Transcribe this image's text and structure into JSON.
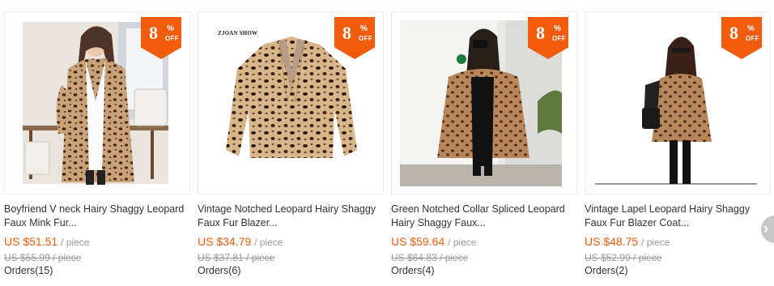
{
  "products": [
    {
      "title": "Boyfriend V neck Hairy Shaggy Leopard Faux Mink Fur...",
      "price": "US $51.51",
      "unit": "/ piece",
      "original_price": "US $55.99 / piece",
      "orders": "Orders(15)",
      "discount": "8",
      "pct": "%",
      "off": "OFF"
    },
    {
      "title": "Vintage Notched Leopard Hairy Shaggy Faux Fur Blazer...",
      "price": "US $34.79",
      "unit": "/ piece",
      "original_price": "US $37.81 / piece",
      "orders": "Orders(6)",
      "discount": "8",
      "pct": "%",
      "off": "OFF",
      "brand": "ZJOAN SHOW"
    },
    {
      "title": "Green Notched Collar Spliced Leopard Hairy Shaggy Faux...",
      "price": "US $59.64",
      "unit": "/ piece",
      "original_price": "US $64.83 / piece",
      "orders": "Orders(4)",
      "discount": "8",
      "pct": "%",
      "off": "OFF"
    },
    {
      "title": "Vintage Lapel Leopard Hairy Shaggy Faux Fur Blazer Coat...",
      "price": "US $48.75",
      "unit": "/ piece",
      "original_price": "US $52.99 / piece",
      "orders": "Orders(2)",
      "discount": "8",
      "pct": "%",
      "off": "OFF"
    }
  ],
  "colors": {
    "accent": "#f25c0c",
    "muted": "#999999",
    "text": "#333333"
  },
  "nav": {
    "next_icon": "chevron-right-icon"
  }
}
